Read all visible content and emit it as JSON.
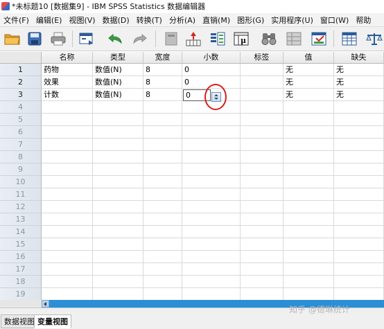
{
  "window": {
    "title": "*未标题10 [数据集9] - IBM SPSS Statistics 数据编辑器"
  },
  "menu": [
    "文件(F)",
    "编辑(E)",
    "视图(V)",
    "数据(D)",
    "转换(T)",
    "分析(A)",
    "直销(M)",
    "图形(G)",
    "实用程序(U)",
    "窗口(W)",
    "帮助"
  ],
  "toolbar": {
    "icons": [
      "open-folder-icon",
      "save-icon",
      "print-icon",
      "dialog-recall-icon",
      "undo-icon",
      "redo-icon",
      "go-to-case-icon",
      "go-to-variable-icon",
      "variables-icon",
      "value-labels-icon",
      "find-icon",
      "insert-cases-icon",
      "insert-variable-icon",
      "split-file-icon",
      "weight-cases-icon"
    ]
  },
  "grid": {
    "columns": [
      "名称",
      "类型",
      "宽度",
      "小数",
      "标签",
      "值",
      "缺失"
    ],
    "rows": [
      {
        "num": "1",
        "cells": [
          "药物",
          "数值(N)",
          "8",
          "0",
          "",
          "无",
          "无"
        ]
      },
      {
        "num": "2",
        "cells": [
          "效果",
          "数值(N)",
          "8",
          "0",
          "",
          "无",
          "无"
        ]
      },
      {
        "num": "3",
        "cells": [
          "计数",
          "数值(N)",
          "8",
          "0",
          "",
          "无",
          "无"
        ]
      }
    ],
    "empty_row_numbers": [
      "4",
      "5",
      "6",
      "7",
      "8",
      "9",
      "10",
      "11",
      "12",
      "13",
      "14",
      "15",
      "16",
      "17",
      "18",
      "19"
    ],
    "active_cell": {
      "row": "3",
      "column": "小数",
      "value": "0"
    }
  },
  "tabs": {
    "data_view": "数据视图",
    "variable_view": "变量视图",
    "active": "variable_view"
  },
  "watermark": "知乎 @德琳统计",
  "colors": {
    "highlight_ring": "#d61c1c",
    "scrollbar": "#2a8fd6",
    "row_header": "#dde4ec"
  }
}
